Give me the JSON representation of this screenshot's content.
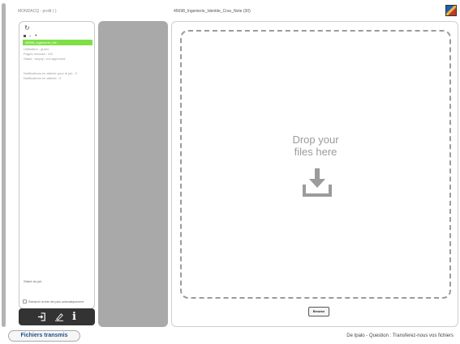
{
  "header": {
    "left_title": "MONDACQ - prolit ( )",
    "center_title": "45698_Ingenierie_Identite_Crav_Note (30)",
    "logo_icon": "app-logo-icon"
  },
  "left_panel": {
    "refresh_icon": "refresh-icon",
    "toolbar": {
      "square_icon": "square-icon",
      "count": "0",
      "caret_icon": "caret-down-icon"
    },
    "selected_job": "45698_Ingenierie_Ide...",
    "info_lines": [
      "Utilisateur : guest",
      "Pages rendues : 0/0",
      "Statut : empty / not approved",
      "",
      "Notifications en attente pour le job : 0",
      "Notifications en attente : 0"
    ],
    "status_label": "Statut du job",
    "auto_refresh_label": "Rafraichir la liste des jobs automatiquement",
    "auto_refresh_checked": false
  },
  "actions": {
    "logout_icon": "logout-icon",
    "sign_icon": "sign-edit-icon",
    "info_label": "i"
  },
  "drop_zone": {
    "line1": "Drop your",
    "line2": "files here",
    "icon": "download-icon"
  },
  "browse_label": "Browse",
  "footer": {
    "tab_label": "Fichiers transmis",
    "right_text": "De Ipalo - Question : Transferez-nous vos fichiers"
  },
  "colors": {
    "selected_job": "#7ee046",
    "rail": "#b3b3b3",
    "gray_column": "#a9a9a9",
    "action_bar": "#333333",
    "drop_text": "#9b9b9b",
    "footer_tab_text": "#1d4f8c"
  }
}
